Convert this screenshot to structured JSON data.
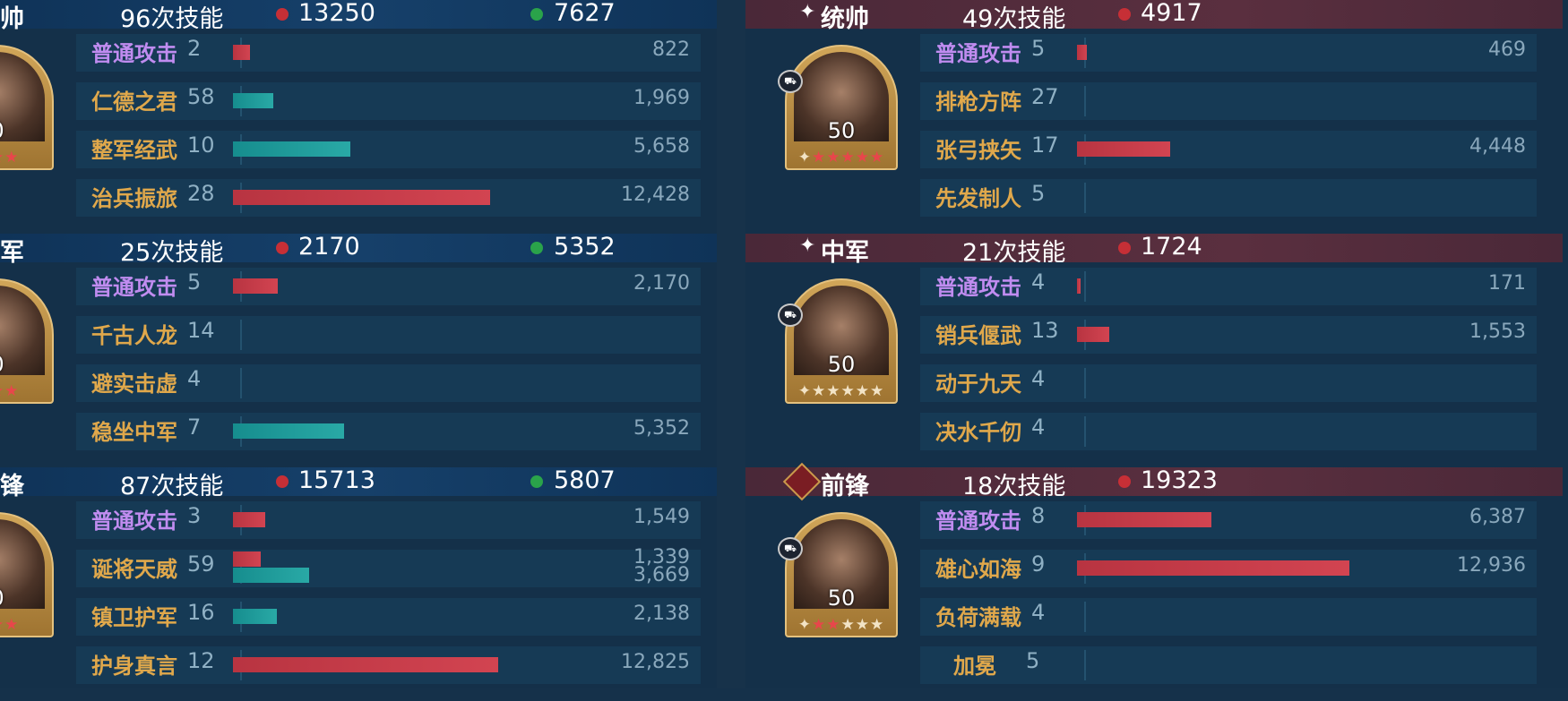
{
  "left": {
    "sections": [
      {
        "role": "帅",
        "count": "96次技能",
        "red_stat": "13250",
        "green_stat": "7627",
        "avatar": {
          "level": "0",
          "stars": "★★★"
        },
        "rows": [
          {
            "name": "普通攻击",
            "lvl": "2",
            "type": "basic",
            "bars": [
              {
                "color": "red",
                "value": 822
              }
            ],
            "labels": [
              "822"
            ]
          },
          {
            "name": "仁德之君",
            "lvl": "58",
            "type": "skill",
            "bars": [
              {
                "color": "teal",
                "value": 1969
              }
            ],
            "labels": [
              "1,969"
            ]
          },
          {
            "name": "整军经武",
            "lvl": "10",
            "type": "skill",
            "bars": [
              {
                "color": "teal",
                "value": 5658
              }
            ],
            "labels": [
              "5,658"
            ]
          },
          {
            "name": "治兵振旅",
            "lvl": "28",
            "type": "skill",
            "bars": [
              {
                "color": "red",
                "value": 12428
              }
            ],
            "labels": [
              "12,428"
            ]
          }
        ]
      },
      {
        "role": "军",
        "count": "25次技能",
        "red_stat": "2170",
        "green_stat": "5352",
        "avatar": {
          "level": "0",
          "stars": "★★★"
        },
        "rows": [
          {
            "name": "普通攻击",
            "lvl": "5",
            "type": "basic",
            "bars": [
              {
                "color": "red",
                "value": 2170
              }
            ],
            "labels": [
              "2,170"
            ]
          },
          {
            "name": "千古人龙",
            "lvl": "14",
            "type": "skill",
            "bars": [],
            "labels": []
          },
          {
            "name": "避实击虚",
            "lvl": "4",
            "type": "skill",
            "bars": [],
            "labels": []
          },
          {
            "name": "稳坐中军",
            "lvl": "7",
            "type": "skill",
            "bars": [
              {
                "color": "teal",
                "value": 5352
              }
            ],
            "labels": [
              "5,352"
            ]
          }
        ]
      },
      {
        "role": "锋",
        "count": "87次技能",
        "red_stat": "15713",
        "green_stat": "5807",
        "avatar": {
          "level": "0",
          "stars": "★★★"
        },
        "rows": [
          {
            "name": "普通攻击",
            "lvl": "3",
            "type": "basic",
            "bars": [
              {
                "color": "red",
                "value": 1549
              }
            ],
            "labels": [
              "1,549"
            ]
          },
          {
            "name": "诞将天威",
            "lvl": "59",
            "type": "skill",
            "bars": [
              {
                "color": "red",
                "value": 1339
              },
              {
                "color": "teal",
                "value": 3669
              }
            ],
            "labels": [
              "1,339",
              "3,669"
            ]
          },
          {
            "name": "镇卫护军",
            "lvl": "16",
            "type": "skill",
            "bars": [
              {
                "color": "teal",
                "value": 2138
              }
            ],
            "labels": [
              "2,138"
            ]
          },
          {
            "name": "护身真言",
            "lvl": "12",
            "type": "skill",
            "bars": [
              {
                "color": "red",
                "value": 12825
              }
            ],
            "labels": [
              "12,825"
            ]
          }
        ]
      }
    ]
  },
  "right": {
    "sections": [
      {
        "role": "统帅",
        "count": "49次技能",
        "red_stat": "4917",
        "icon": "spark-icon",
        "avatar": {
          "level": "50",
          "stars_red": "★★★★★",
          "stars_light": ""
        },
        "rows": [
          {
            "name": "普通攻击",
            "lvl": "5",
            "type": "basic",
            "bars": [
              {
                "color": "red",
                "value": 469
              }
            ],
            "labels": [
              "469"
            ]
          },
          {
            "name": "排枪方阵",
            "lvl": "27",
            "type": "skill",
            "bars": [],
            "labels": []
          },
          {
            "name": "张弓挟矢",
            "lvl": "17",
            "type": "skill",
            "bars": [
              {
                "color": "red",
                "value": 4448
              }
            ],
            "labels": [
              "4,448"
            ]
          },
          {
            "name": "先发制人",
            "lvl": "5",
            "type": "skill",
            "bars": [],
            "labels": []
          }
        ]
      },
      {
        "role": "中军",
        "count": "21次技能",
        "red_stat": "1724",
        "icon": "spark-icon",
        "avatar": {
          "level": "50",
          "stars_red": "",
          "stars_light": "★★★★★"
        },
        "rows": [
          {
            "name": "普通攻击",
            "lvl": "4",
            "type": "basic",
            "bars": [
              {
                "color": "red",
                "value": 171
              }
            ],
            "labels": [
              "171"
            ]
          },
          {
            "name": "销兵偃武",
            "lvl": "13",
            "type": "skill",
            "bars": [
              {
                "color": "red",
                "value": 1553
              }
            ],
            "labels": [
              "1,553"
            ]
          },
          {
            "name": "动于九天",
            "lvl": "4",
            "type": "skill",
            "bars": [],
            "labels": []
          },
          {
            "name": "决水千仞",
            "lvl": "4",
            "type": "skill",
            "bars": [],
            "labels": []
          }
        ]
      },
      {
        "role": "前锋",
        "count": "18次技能",
        "red_stat": "19323",
        "icon": "banner-icon",
        "avatar": {
          "level": "50",
          "stars_red": "★★",
          "stars_light": "★★★"
        },
        "rows": [
          {
            "name": "普通攻击",
            "lvl": "8",
            "type": "basic",
            "bars": [
              {
                "color": "red",
                "value": 6387
              }
            ],
            "labels": [
              "6,387"
            ]
          },
          {
            "name": "雄心如海",
            "lvl": "9",
            "type": "skill",
            "bars": [
              {
                "color": "red",
                "value": 12936
              }
            ],
            "labels": [
              "12,936"
            ]
          },
          {
            "name": "负荷满载",
            "lvl": "4",
            "type": "skill",
            "bars": [],
            "labels": []
          },
          {
            "name": "加冕",
            "lvl": "5",
            "type": "skill",
            "bars": [],
            "labels": []
          }
        ]
      }
    ]
  },
  "colors": {
    "basic_attack_name": "#c08cf0",
    "skill_name": "#e0a84b",
    "damage_bar": "#c43a47",
    "heal_bar": "#1f9c9c",
    "damage_dot": "#c62f36",
    "heal_dot": "#2aa34a"
  }
}
